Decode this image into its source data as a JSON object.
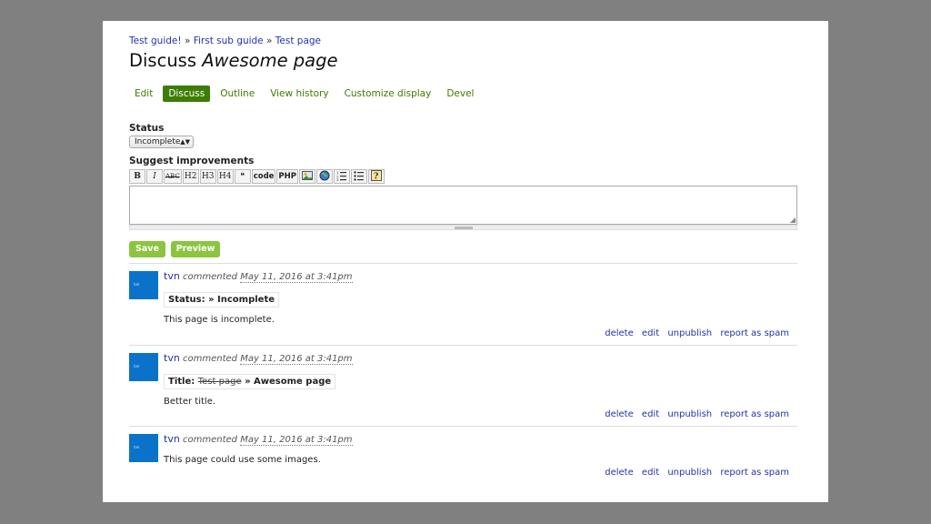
{
  "breadcrumb": {
    "items": [
      "Test guide!",
      "First sub guide",
      "Test page"
    ],
    "separator": "»"
  },
  "title": {
    "prefix": "Discuss",
    "name": "Awesome page"
  },
  "tabs": [
    {
      "label": "Edit",
      "active": false
    },
    {
      "label": "Discuss",
      "active": true
    },
    {
      "label": "Outline",
      "active": false
    },
    {
      "label": "View history",
      "active": false
    },
    {
      "label": "Customize display",
      "active": false
    },
    {
      "label": "Devel",
      "active": false
    }
  ],
  "form": {
    "status_label": "Status",
    "status_value": "Incomplete",
    "suggest_label": "Suggest improvements",
    "toolbar": {
      "bold": "B",
      "italic": "I",
      "strike": "ABC",
      "h2": "H2",
      "h3": "H3",
      "h4": "H4",
      "code": "code",
      "php": "PHP"
    },
    "textarea_value": "",
    "save_label": "Save",
    "preview_label": "Preview"
  },
  "comments": [
    {
      "avatar": "tvn",
      "user": "tvn",
      "verb": "commented",
      "date": "May 11, 2016 at 3:41pm",
      "change": {
        "field": "Status:",
        "old": "",
        "new": "» Incomplete"
      },
      "text": "This page is incomplete.",
      "actions": [
        "delete",
        "edit",
        "unpublish",
        "report as spam"
      ]
    },
    {
      "avatar": "tvn",
      "user": "tvn",
      "verb": "commented",
      "date": "May 11, 2016 at 3:41pm",
      "change": {
        "field": "Title:",
        "old": "Test page",
        "new": "» Awesome page"
      },
      "text": "Better title.",
      "actions": [
        "delete",
        "edit",
        "unpublish",
        "report as spam"
      ]
    },
    {
      "avatar": "tvn",
      "user": "tvn",
      "verb": "commented",
      "date": "May 11, 2016 at 3:41pm",
      "text": "This page could use some images.",
      "actions": [
        "delete",
        "edit",
        "unpublish",
        "report as spam"
      ]
    }
  ],
  "colors": {
    "tab_active": "#3e7d05",
    "tab_text": "#3f7a00",
    "button": "#8bc53f",
    "avatar": "#0a73c9",
    "link": "#2233aa"
  }
}
